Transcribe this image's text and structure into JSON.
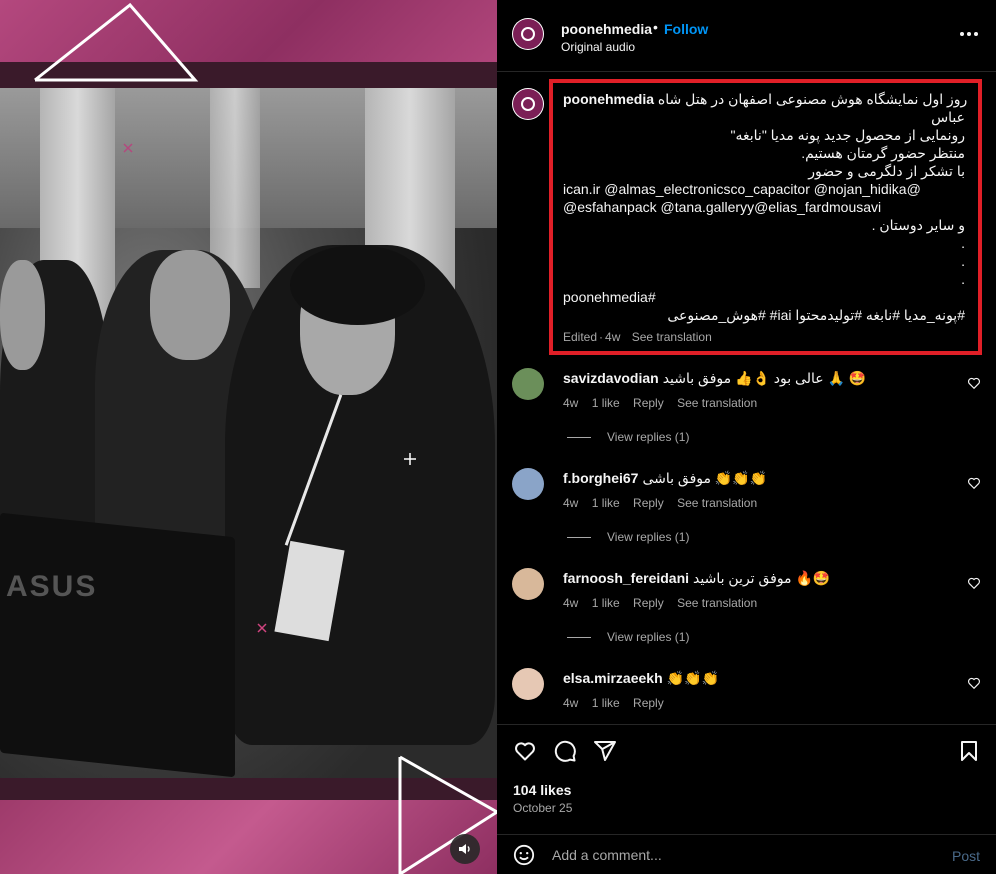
{
  "media": {
    "monitor_brand": "ASUS",
    "sound": "muted"
  },
  "header": {
    "username": "poonehmedia",
    "separator": "•",
    "follow_label": "Follow",
    "audio_label": "Original audio"
  },
  "caption": {
    "username": "poonehmedia",
    "lines": [
      "روز اول نمایشگاه هوش مصنوعی اصفهان در هتل شاه",
      "عباس",
      "رونمایی از محصول جدید پونه مدیا \"نابغه\"",
      "منتظر حضور گرمتان هستیم.",
      "با تشکر از دلگرمی و حضور",
      "ican.ir @almas_electronicsco_capacitor @nojan_hidika@",
      "@esfahanpack @tana.galleryy@elias_fardmousavi",
      "و سایر دوستان .",
      ".",
      ".",
      ".",
      "poonehmedia#",
      "#پونه_مدیا #نابغه #تولیدمحتوا iai# #هوش_مصنوعی"
    ],
    "edited": "Edited",
    "time": "4w",
    "see_translation": "See translation"
  },
  "comments": [
    {
      "username": "savizdavodian",
      "text": "عالی بود 👌👍 موفق باشید 🙏 🤩",
      "time": "4w",
      "likes": "1 like",
      "reply": "Reply",
      "translation": "See translation",
      "view_replies": "View replies (1)"
    },
    {
      "username": "f.borghei67",
      "text": "موفق باشی 👏👏👏",
      "time": "4w",
      "likes": "1 like",
      "reply": "Reply",
      "translation": "See translation",
      "view_replies": "View replies (1)"
    },
    {
      "username": "farnoosh_fereidani",
      "text": "موفق ترین باشید 🔥🤩",
      "time": "4w",
      "likes": "1 like",
      "reply": "Reply",
      "translation": "See translation",
      "view_replies": "View replies (1)"
    },
    {
      "username": "elsa.mirzaeekh",
      "text": "👏👏👏",
      "time": "4w",
      "likes": "1 like",
      "reply": "Reply",
      "translation": "",
      "view_replies": ""
    }
  ],
  "actions": {
    "likes": "104 likes",
    "date": "October 25"
  },
  "add_comment": {
    "placeholder": "Add a comment...",
    "post_label": "Post"
  },
  "colors": {
    "accent_blue": "#0095f6",
    "highlight_red": "#e01f27",
    "brand_magenta": "#b4487e"
  }
}
